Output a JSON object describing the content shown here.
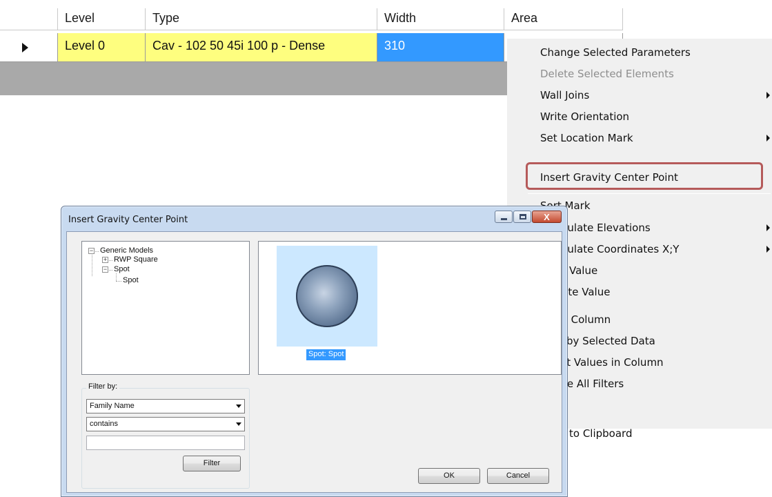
{
  "grid": {
    "columns": [
      "Level",
      "Type",
      "Width",
      "Area"
    ],
    "row": {
      "level": "Level 0",
      "type": "Cav - 102 50 45i 100 p - Dense",
      "width": "310",
      "area": ""
    }
  },
  "context_menu": {
    "items": [
      {
        "label": "Change Selected Parameters",
        "enabled": true,
        "submenu": false
      },
      {
        "label": "Delete Selected Elements",
        "enabled": false,
        "submenu": false
      },
      {
        "label": "Wall Joins",
        "enabled": true,
        "submenu": true
      },
      {
        "label": "Write Orientation",
        "enabled": true,
        "submenu": false
      },
      {
        "label": "Set Location Mark",
        "enabled": true,
        "submenu": true
      },
      {
        "label": "Insert Gravity Center Point",
        "enabled": true,
        "submenu": false,
        "highlighted": true
      },
      {
        "label": "Sort Mark",
        "enabled": true,
        "submenu": false
      },
      {
        "label": "lculate Elevations",
        "enabled": true,
        "submenu": true
      },
      {
        "label": "lculate Coordinates X;Y",
        "enabled": true,
        "submenu": true
      },
      {
        "label": "Value",
        "enabled": true,
        "submenu": false
      },
      {
        "label": "late Value",
        "enabled": true,
        "submenu": false
      },
      {
        "label": "t Column",
        "enabled": true,
        "submenu": false
      },
      {
        "label": "by Selected Data",
        "enabled": true,
        "submenu": false
      },
      {
        "label": "ct Values in Column",
        "enabled": true,
        "submenu": false
      },
      {
        "label": "ve All Filters",
        "enabled": true,
        "submenu": false
      },
      {
        "label": "to Clipboard",
        "enabled": true,
        "submenu": false
      }
    ],
    "highlight_color": "#b55a5a"
  },
  "dialog": {
    "title": "Insert Gravity Center Point",
    "close_glyph": "X",
    "tree": {
      "root": "Generic Models",
      "children": [
        {
          "label": "RWP Square",
          "expanded": false
        },
        {
          "label": "Spot",
          "expanded": true,
          "children": [
            "Spot"
          ]
        }
      ]
    },
    "preview": {
      "caption": "Spot: Spot"
    },
    "filter": {
      "legend": "Filter by:",
      "field_value": "Family Name",
      "operator_value": "contains",
      "text_value": "",
      "filter_button": "Filter"
    },
    "ok_button": "OK",
    "cancel_button": "Cancel"
  },
  "colors": {
    "row_yellow": "#fefe7f",
    "selection_blue": "#3399ff",
    "grid_empty_gray": "#a9a9a9"
  }
}
